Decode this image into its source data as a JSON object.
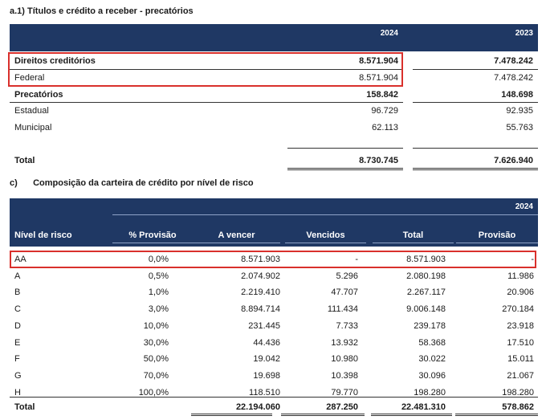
{
  "section_a": {
    "letter": "a.1)",
    "title": "Títulos e crédito a receber - precatórios",
    "years": [
      "2024",
      "2023"
    ],
    "rows": [
      {
        "label": "Direitos creditórios",
        "v2024": "8.571.904",
        "v2023": "7.478.242",
        "bold": true
      },
      {
        "label": "Federal",
        "v2024": "8.571.904",
        "v2023": "7.478.242",
        "bold": false
      },
      {
        "label": "Precatórios",
        "v2024": "158.842",
        "v2023": "148.698",
        "bold": true
      },
      {
        "label": "Estadual",
        "v2024": "96.729",
        "v2023": "92.935",
        "bold": false
      },
      {
        "label": "Municipal",
        "v2024": "62.113",
        "v2023": "55.763",
        "bold": false
      }
    ],
    "total": {
      "label": "Total",
      "v2024": "8.730.745",
      "v2023": "7.626.940"
    }
  },
  "section_c": {
    "letter": "c)",
    "title": "Composição da carteira de crédito por nível de risco",
    "year": "2024",
    "columns": [
      "Nível de risco",
      "% Provisão",
      "A vencer",
      "Vencidos",
      "Total",
      "Provisão"
    ],
    "rows": [
      [
        "AA",
        "0,0%",
        "8.571.903",
        "-",
        "8.571.903",
        "-"
      ],
      [
        "A",
        "0,5%",
        "2.074.902",
        "5.296",
        "2.080.198",
        "11.986"
      ],
      [
        "B",
        "1,0%",
        "2.219.410",
        "47.707",
        "2.267.117",
        "20.906"
      ],
      [
        "C",
        "3,0%",
        "8.894.714",
        "111.434",
        "9.006.148",
        "270.184"
      ],
      [
        "D",
        "10,0%",
        "231.445",
        "7.733",
        "239.178",
        "23.918"
      ],
      [
        "E",
        "30,0%",
        "44.436",
        "13.932",
        "58.368",
        "17.510"
      ],
      [
        "F",
        "50,0%",
        "19.042",
        "10.980",
        "30.022",
        "15.011"
      ],
      [
        "G",
        "70,0%",
        "19.698",
        "10.398",
        "30.096",
        "21.067"
      ],
      [
        "H",
        "100,0%",
        "118.510",
        "79.770",
        "198.280",
        "198.280"
      ]
    ],
    "total": {
      "label": "Total",
      "a_vencer": "22.194.060",
      "vencidos": "287.250",
      "total": "22.481.310",
      "provisao": "578.862"
    }
  },
  "colors": {
    "header_bg": "#1f3864",
    "highlight_border": "#d9302c"
  }
}
